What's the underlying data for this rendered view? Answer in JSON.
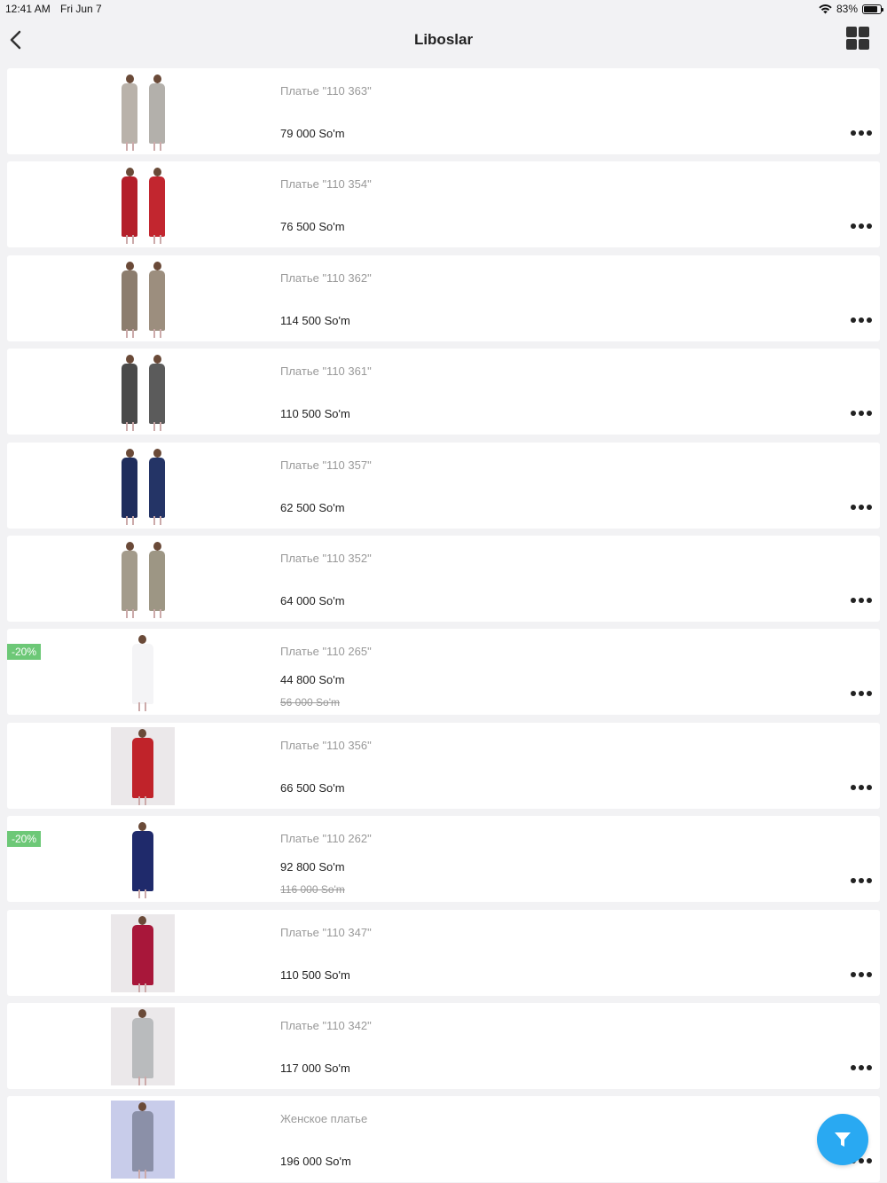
{
  "status": {
    "time": "12:41 AM",
    "date": "Fri Jun 7",
    "battery": "83%",
    "battery_level": 0.83
  },
  "nav": {
    "title": "Liboslar"
  },
  "products": [
    {
      "name": "Платье \"110 363\"",
      "price": "79 000 So'm",
      "colors": [
        "#b9b2aa",
        "#b3b0ab"
      ],
      "figure": "pair"
    },
    {
      "name": "Платье \"110 354\"",
      "price": "76 500 So'm",
      "colors": [
        "#b41f2a",
        "#c2262f"
      ],
      "figure": "pair"
    },
    {
      "name": "Платье \"110 362\"",
      "price": "114 500 So'm",
      "colors": [
        "#8c7d6e",
        "#9c8e7e"
      ],
      "figure": "pair"
    },
    {
      "name": "Платье \"110 361\"",
      "price": "110 500 So'm",
      "colors": [
        "#4a4a4a",
        "#5b5b5b"
      ],
      "figure": "pair"
    },
    {
      "name": "Платье \"110 357\"",
      "price": "62 500 So'm",
      "colors": [
        "#1f2d5c",
        "#243466"
      ],
      "figure": "pair"
    },
    {
      "name": "Платье \"110 352\"",
      "price": "64 000 So'm",
      "colors": [
        "#a39b8b",
        "#9d9684"
      ],
      "figure": "pair"
    },
    {
      "name": "Платье \"110 265\"",
      "price": "44 800 So'm",
      "old_price": "56 000 So'm",
      "badge": "-20%",
      "colors": [
        "#f4f4f6"
      ],
      "figure": "single"
    },
    {
      "name": "Платье \"110 356\"",
      "price": "66 500 So'm",
      "colors": [
        "#c0232a"
      ],
      "figure": "boxed"
    },
    {
      "name": "Платье \"110 262\"",
      "price": "92 800 So'm",
      "old_price": "116 000 So'm",
      "badge": "-20%",
      "colors": [
        "#1f2a6b"
      ],
      "figure": "single"
    },
    {
      "name": "Платье \"110 347\"",
      "price": "110 500 So'm",
      "colors": [
        "#a8173a"
      ],
      "figure": "boxed"
    },
    {
      "name": "Платье \"110 342\"",
      "price": "117 000 So'm",
      "colors": [
        "#b9bbbd"
      ],
      "figure": "boxed"
    },
    {
      "name": "Женское платье",
      "price": "196 000 So'm",
      "colors": [
        "#8b90a8"
      ],
      "figure": "boxed-blue"
    }
  ]
}
